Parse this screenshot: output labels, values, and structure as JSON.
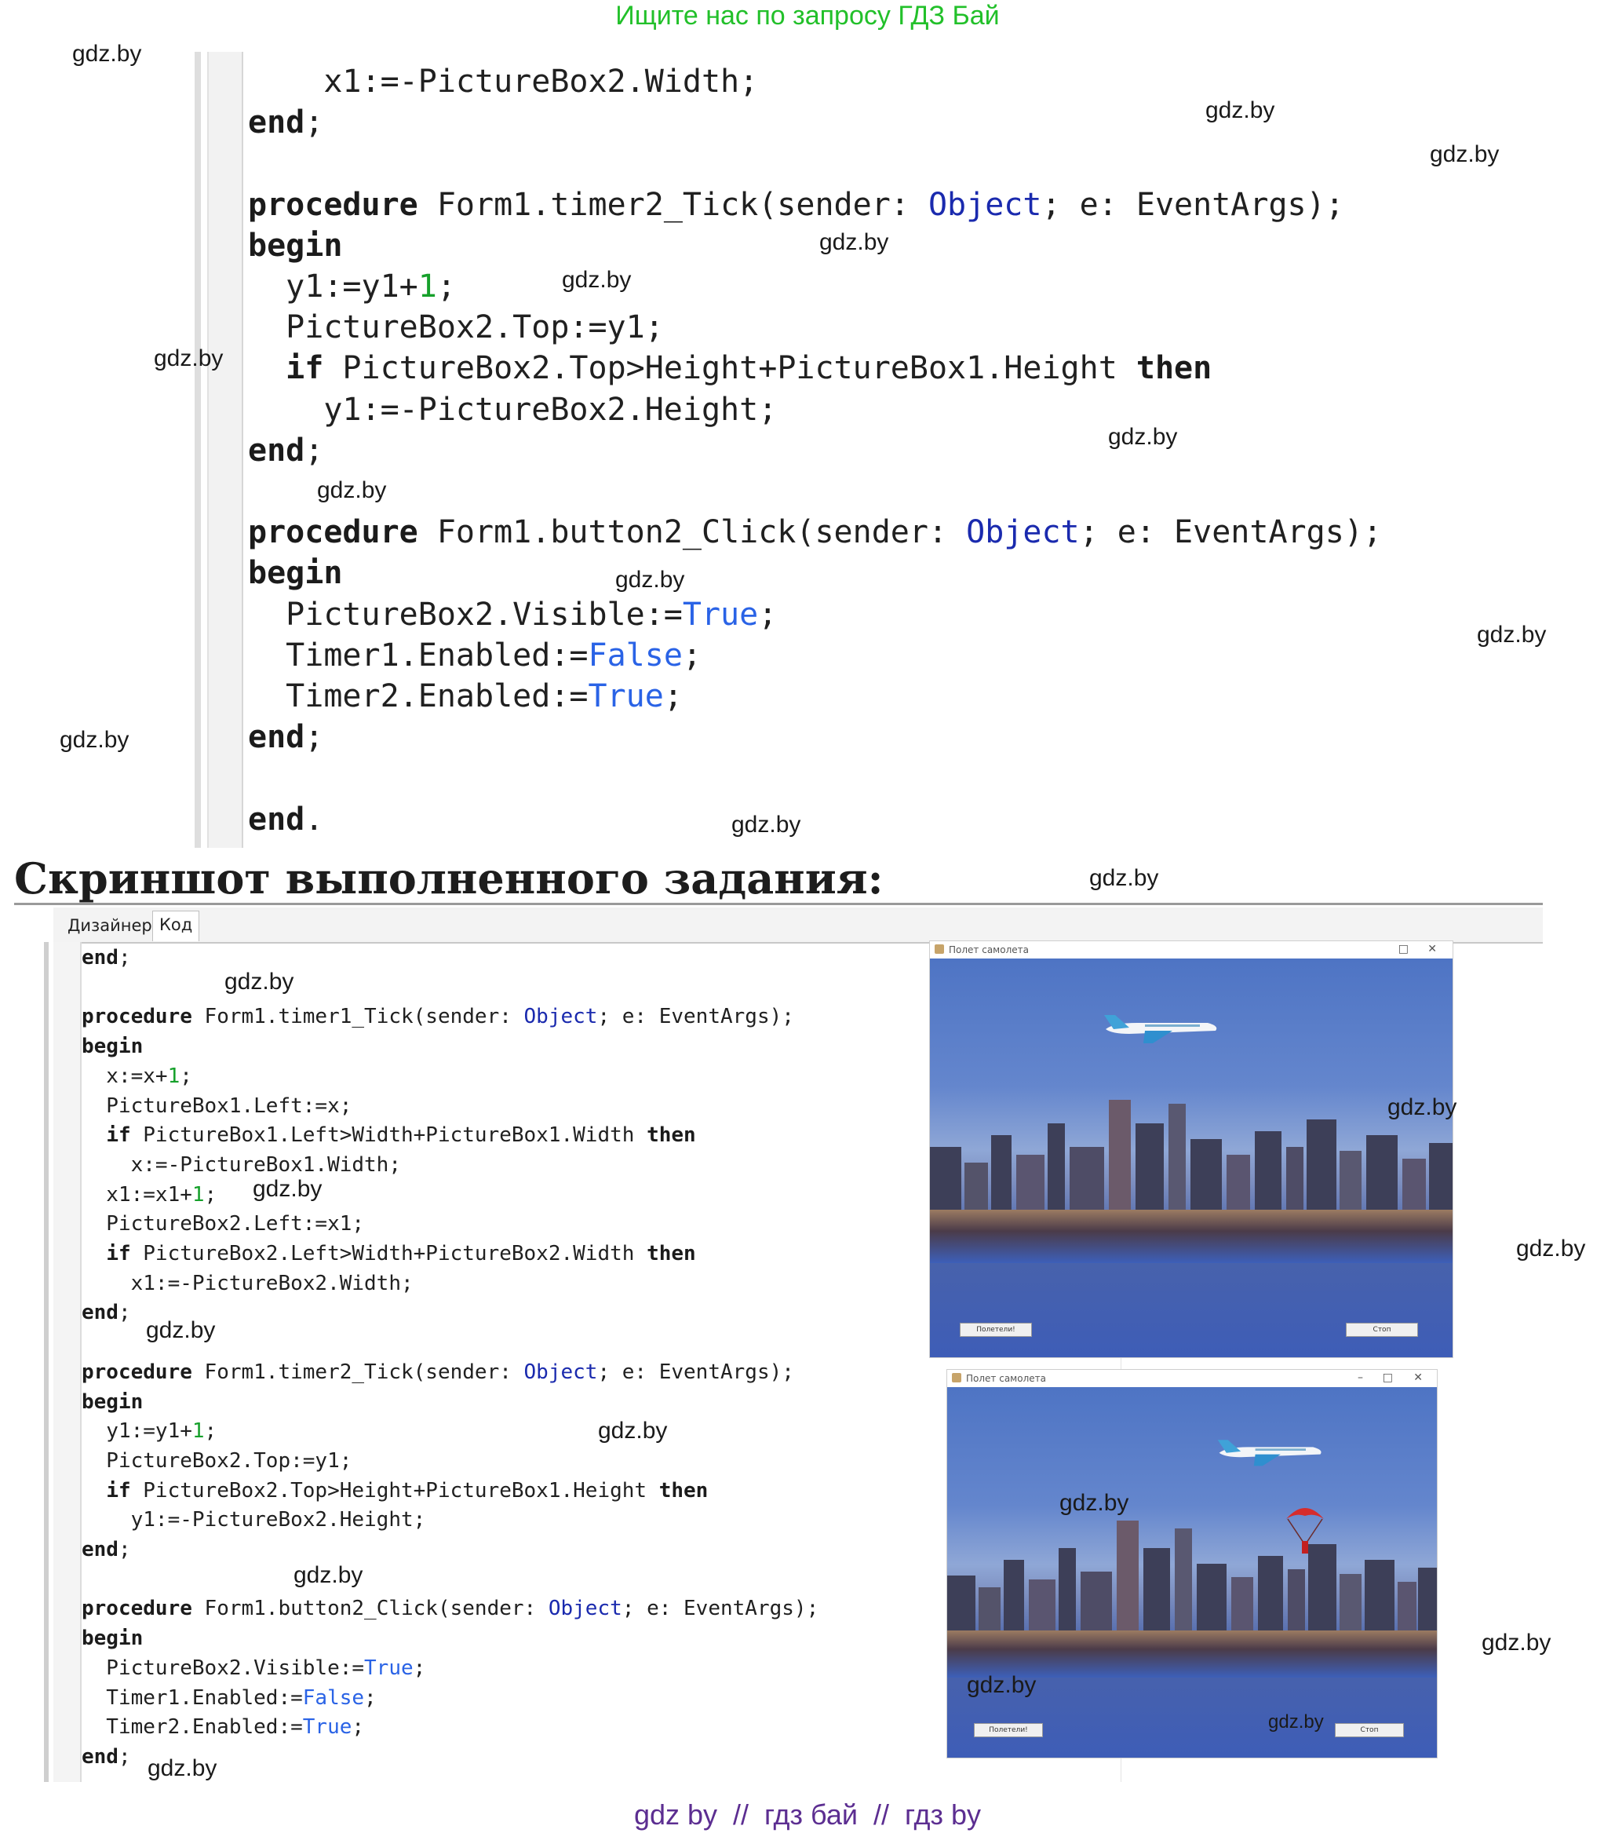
{
  "banner": {
    "text": "Ищите нас по запросу ГДЗ Бай"
  },
  "watermark": "gdz.by",
  "section_title": "Скриншот выполненного задания:",
  "editor": {
    "tabs": [
      "Дизайнер",
      "Код"
    ]
  },
  "app_window": {
    "title": "Полет самолета",
    "start_button": "Полетели!",
    "stop_button": "Стоп"
  },
  "footer": {
    "text": "gdz by  //  гдз бай  //  гдз by"
  },
  "colors": {
    "banner": "#22c02a",
    "footer": "#5c2e91",
    "keyword_type": "#1a2aae",
    "literal": "#2a63e6",
    "number": "#16a02b"
  }
}
